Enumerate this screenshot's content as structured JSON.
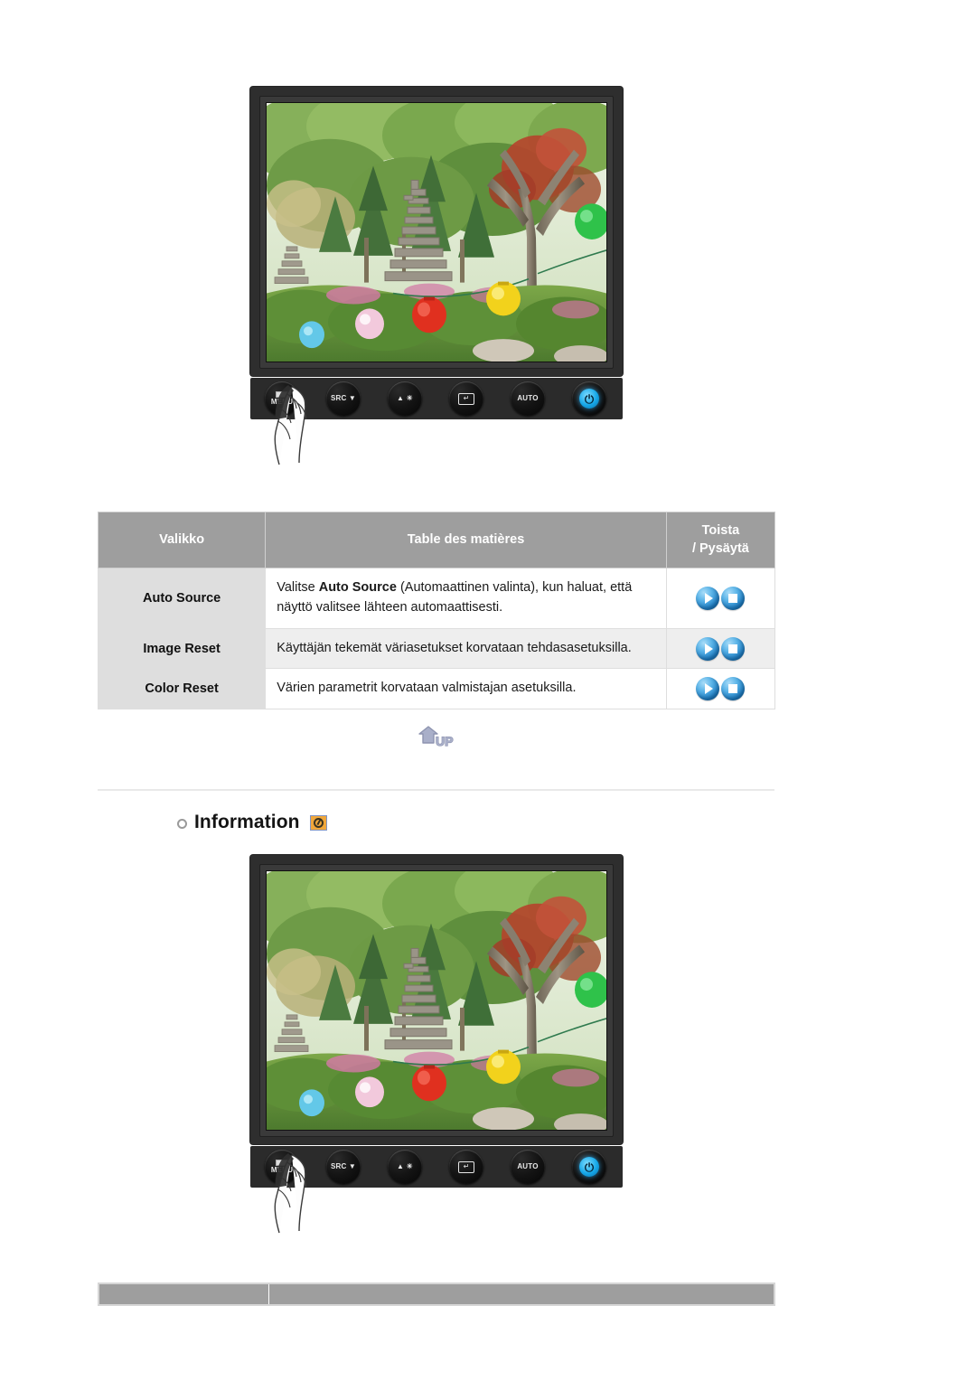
{
  "page": {
    "background": "#ffffff",
    "header_bg": "#9e9e9e",
    "row_label_bg": "#dedede",
    "alt_row_bg": "#eeeeee",
    "accent_orange": "#f0a73b",
    "orb_blue": "#1e7fc7"
  },
  "monitor_top": {
    "name": "lcd-monitor-illustration-top",
    "buttons": [
      {
        "id": "menu",
        "label_top": "menu-bars",
        "label": "MENU"
      },
      {
        "id": "source-down",
        "label": "SOURCE",
        "sub": "down-arrow"
      },
      {
        "id": "brightness",
        "label": "up-arrow",
        "sub": "brightness-sun"
      },
      {
        "id": "enter",
        "label": "enter-arrow"
      },
      {
        "id": "auto",
        "label": "AUTO"
      },
      {
        "id": "power",
        "label": "power-symbol"
      }
    ],
    "hand_cursor": "pointing-hand-on-menu-button"
  },
  "osd_table": {
    "name": "osd-setup-table",
    "headers": {
      "menu": "Valikko",
      "contents": "Table des matières",
      "play_stop_line1": "Toista",
      "play_stop_line2": "/ Pysäytä"
    },
    "rows": [
      {
        "menu": "Auto Source",
        "desc_prefix": "Valitse ",
        "desc_bold": "Auto Source",
        "desc_suffix": " (Automaattinen valinta), kun haluat, että näyttö valitsee lähteen automaattisesti.",
        "play_label": "Toista",
        "stop_label": "Pysäytä",
        "alt": false
      },
      {
        "menu": "Image Reset",
        "desc_prefix": "",
        "desc_bold": "",
        "desc_suffix": "Käyttäjän tekemät väriasetukset korvataan tehdasasetuksilla.",
        "play_label": "Toista",
        "stop_label": "Pysäytä",
        "alt": true
      },
      {
        "menu": "Color Reset",
        "desc_prefix": "",
        "desc_bold": "",
        "desc_suffix": "Värien parametrit korvataan valmistajan asetuksilla.",
        "play_label": "Toista",
        "stop_label": "Pysäytä",
        "alt": false
      }
    ]
  },
  "up_button": {
    "name": "up-scroll-button",
    "label": "UP"
  },
  "information_section": {
    "name": "information-section-heading",
    "title": "Information",
    "icon": "information-dial-icon"
  },
  "monitor_bottom": {
    "name": "lcd-monitor-illustration-bottom",
    "buttons": [
      {
        "id": "menu",
        "label": "MENU"
      },
      {
        "id": "source-down",
        "label": "SOURCE"
      },
      {
        "id": "brightness",
        "label": "brightness"
      },
      {
        "id": "enter",
        "label": "enter"
      },
      {
        "id": "auto",
        "label": "AUTO"
      },
      {
        "id": "power",
        "label": "power"
      }
    ],
    "hand_cursor": "pointing-hand-on-menu-button"
  },
  "footer": {
    "name": "footer-bar",
    "cells": [
      "",
      ""
    ]
  }
}
